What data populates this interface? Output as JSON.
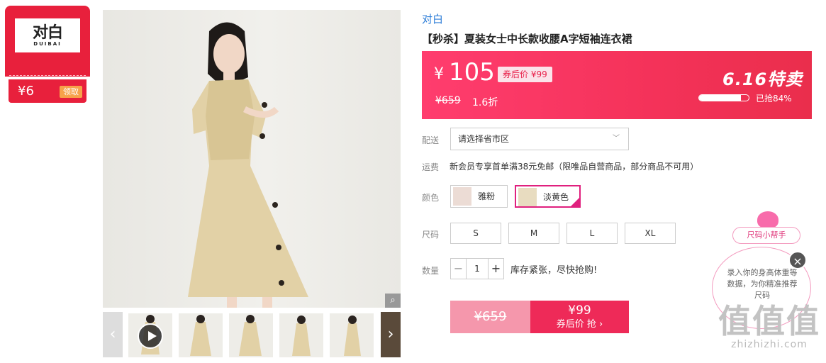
{
  "coupon": {
    "logo_text": "对白",
    "logo_sub": "DUIBAI",
    "amount": "¥6",
    "get_label": "领取"
  },
  "gallery": {
    "zoom_icon": "magnifier-icon",
    "thumbnail_count": 6
  },
  "product": {
    "brand": "对白",
    "title": "【秒杀】夏装女士中长款收腰A字短袖连衣裙"
  },
  "price_banner": {
    "currency": "¥",
    "price": "105",
    "after_coupon": "券后价 ¥99",
    "original": "¥659",
    "discount": "1.6折",
    "event": "6.16特卖",
    "grabbed_label": "已抢84%",
    "grabbed_fraction": 0.84
  },
  "delivery": {
    "label": "配送",
    "placeholder": "请选择省市区"
  },
  "shipping": {
    "label": "运费",
    "text": "新会员专享首单满38元免邮（限唯品自营商品，部分商品不可用）"
  },
  "colors": {
    "label": "颜色",
    "options": [
      "雅粉",
      "淡黄色"
    ],
    "selected": "淡黄色"
  },
  "sizes": {
    "label": "尺码",
    "options": [
      "S",
      "M",
      "L",
      "XL"
    ]
  },
  "quantity": {
    "label": "数量",
    "minus": "−",
    "plus": "+",
    "value": "1",
    "stock_text": "库存紧张，尽快抢购!"
  },
  "buy_button": {
    "original": "¥659",
    "price": "¥99",
    "label": "券后价 抢 ›"
  },
  "size_helper": {
    "tag": "尺码小帮手",
    "text": "录入你的身高体重等数据，为你精准推荐尺码",
    "close": "×"
  },
  "watermark": {
    "big": "值值值",
    "small": "zhizhizhi.com"
  },
  "colors_theme": {
    "accent": "#ee2a58",
    "brand_link": "#2e7ed8",
    "selected_border": "#e0207e"
  }
}
